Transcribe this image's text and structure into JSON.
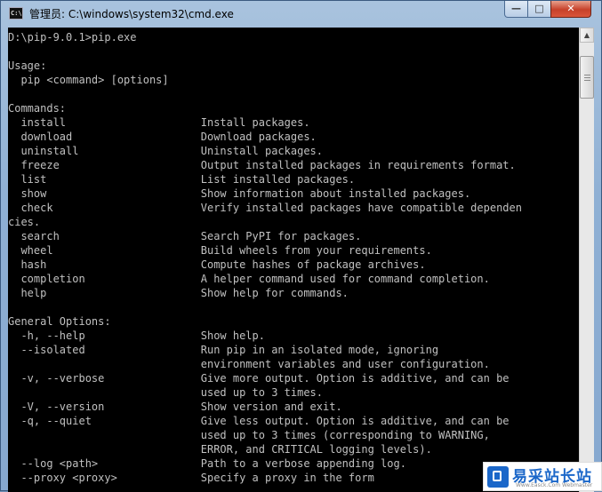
{
  "window": {
    "title": "管理员: C:\\windows\\system32\\cmd.exe",
    "app_icon_text": "C:\\",
    "controls": {
      "minimize": "—",
      "maximize": "□",
      "close": "✕"
    }
  },
  "console": {
    "lines": [
      "D:\\pip-9.0.1>pip.exe",
      "",
      "Usage:",
      "  pip <command> [options]",
      "",
      "Commands:",
      "  install                     Install packages.",
      "  download                    Download packages.",
      "  uninstall                   Uninstall packages.",
      "  freeze                      Output installed packages in requirements format.",
      "  list                        List installed packages.",
      "  show                        Show information about installed packages.",
      "  check                       Verify installed packages have compatible dependen",
      "cies.",
      "  search                      Search PyPI for packages.",
      "  wheel                       Build wheels from your requirements.",
      "  hash                        Compute hashes of package archives.",
      "  completion                  A helper command used for command completion.",
      "  help                        Show help for commands.",
      "",
      "General Options:",
      "  -h, --help                  Show help.",
      "  --isolated                  Run pip in an isolated mode, ignoring",
      "                              environment variables and user configuration.",
      "  -v, --verbose               Give more output. Option is additive, and can be",
      "                              used up to 3 times.",
      "  -V, --version               Show version and exit.",
      "  -q, --quiet                 Give less output. Option is additive, and can be",
      "                              used up to 3 times (corresponding to WARNING,",
      "                              ERROR, and CRITICAL logging levels).",
      "  --log <path>                Path to a verbose appending log.",
      "  --proxy <proxy>             Specify a proxy in the form"
    ]
  },
  "scrollbar": {
    "up_arrow": "▲",
    "down_arrow": "▼"
  },
  "watermark": {
    "brand": "易采站长站",
    "tagline": "Www.Easck.Com  Webmaster"
  }
}
